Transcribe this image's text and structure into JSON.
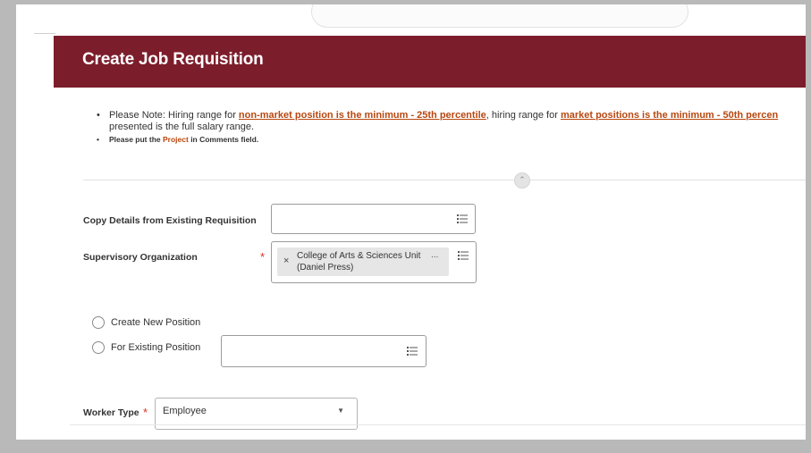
{
  "header": {
    "title": "Create Job Requisition"
  },
  "notes": {
    "line1_prefix": "Please Note: Hiring range for ",
    "line1_link1": "non-market position is the minimum - 25th percentile",
    "line1_mid": ", hiring range for ",
    "line1_link2": "market positions is the minimum - 50th percen",
    "line1_cont": "presented is the full salary range.",
    "line2_prefix": "Please put the ",
    "line2_highlight": "Project",
    "line2_suffix": " in Comments field."
  },
  "form": {
    "copy_details_label": "Copy Details from Existing Requisition",
    "supervisory_org_label": "Supervisory Organization",
    "supervisory_org_value": "College of Arts & Sciences Unit (Daniel Press)",
    "chip_more": "...",
    "chip_remove": "×",
    "required_marker": "*",
    "create_new_position": "Create New Position",
    "for_existing_position": "For Existing Position",
    "worker_type_label": "Worker Type",
    "worker_type_value": "Employee"
  },
  "colors": {
    "header_bg": "#7c1d2b",
    "link": "#b8470f",
    "required": "#d93025"
  },
  "icons": {
    "prompt": "list-icon",
    "collapse": "chevron-up-icon",
    "dropdown": "chevron-down-icon"
  }
}
